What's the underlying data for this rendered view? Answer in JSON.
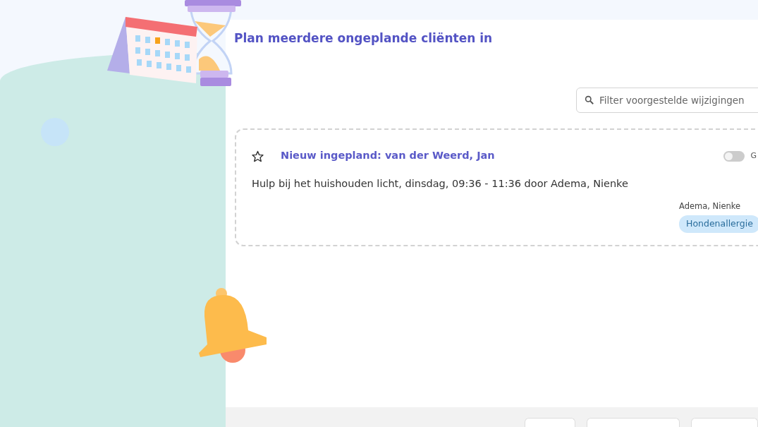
{
  "dialog": {
    "title": "Plan meerdere ongeplande cliënten in"
  },
  "filter": {
    "placeholder": "Filter voorgestelde wijzigingen"
  },
  "suggestions": [
    {
      "starred": false,
      "title": "Nieuw ingepland: van der Weerd, Jan",
      "description": "Hulp bij het huishouden licht, dinsdag, 09:36 - 11:36 door Adema, Nienke",
      "toggle": {
        "on": false,
        "label": "G"
      },
      "assignee": "Adema, Nienke",
      "tags": [
        "Hondenallergie"
      ]
    }
  ]
}
